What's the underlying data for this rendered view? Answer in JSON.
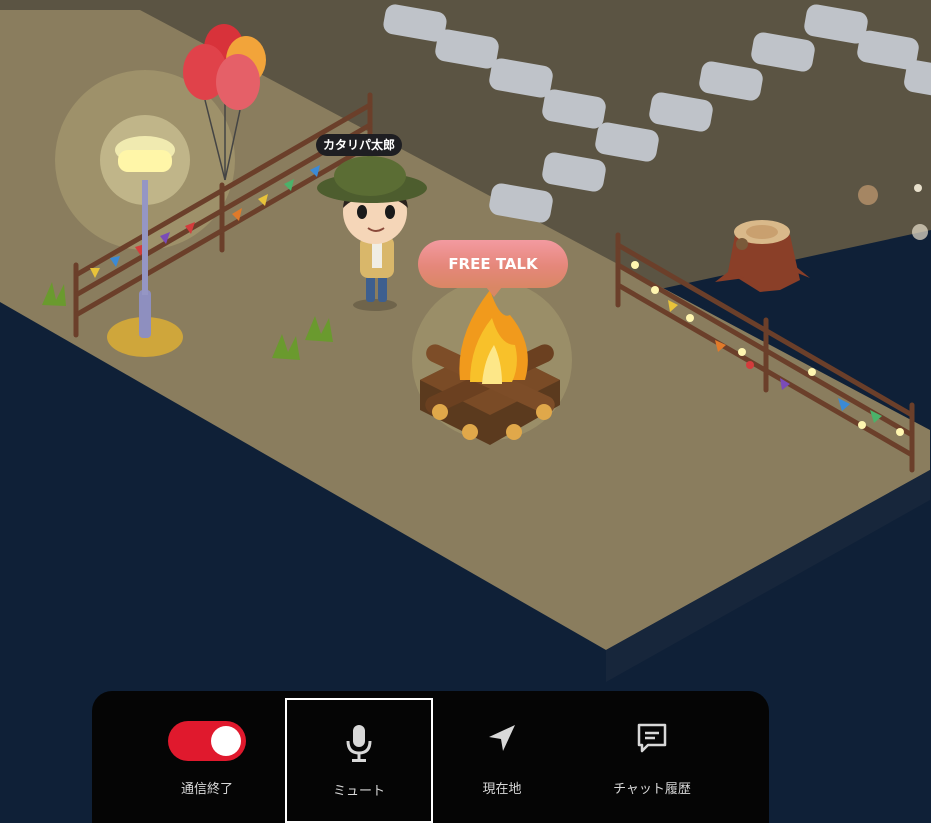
{
  "scene": {
    "character_name": "カタリパ太郎",
    "event_label": "FREE TALK"
  },
  "toolbar": {
    "items": [
      {
        "label": "通信終了",
        "icon": "toggle-switch-on",
        "state": "on"
      },
      {
        "label": "ミュート",
        "icon": "microphone-icon",
        "selected": true
      },
      {
        "label": "現在地",
        "icon": "location-arrow-icon"
      },
      {
        "label": "チャット履歴",
        "icon": "chat-bubble-icon"
      }
    ]
  },
  "colors": {
    "toggle_on": "#e0192d",
    "toolbar_bg": "#050505",
    "void_bg": "#0f2037",
    "ground": "#8a7d5e"
  }
}
